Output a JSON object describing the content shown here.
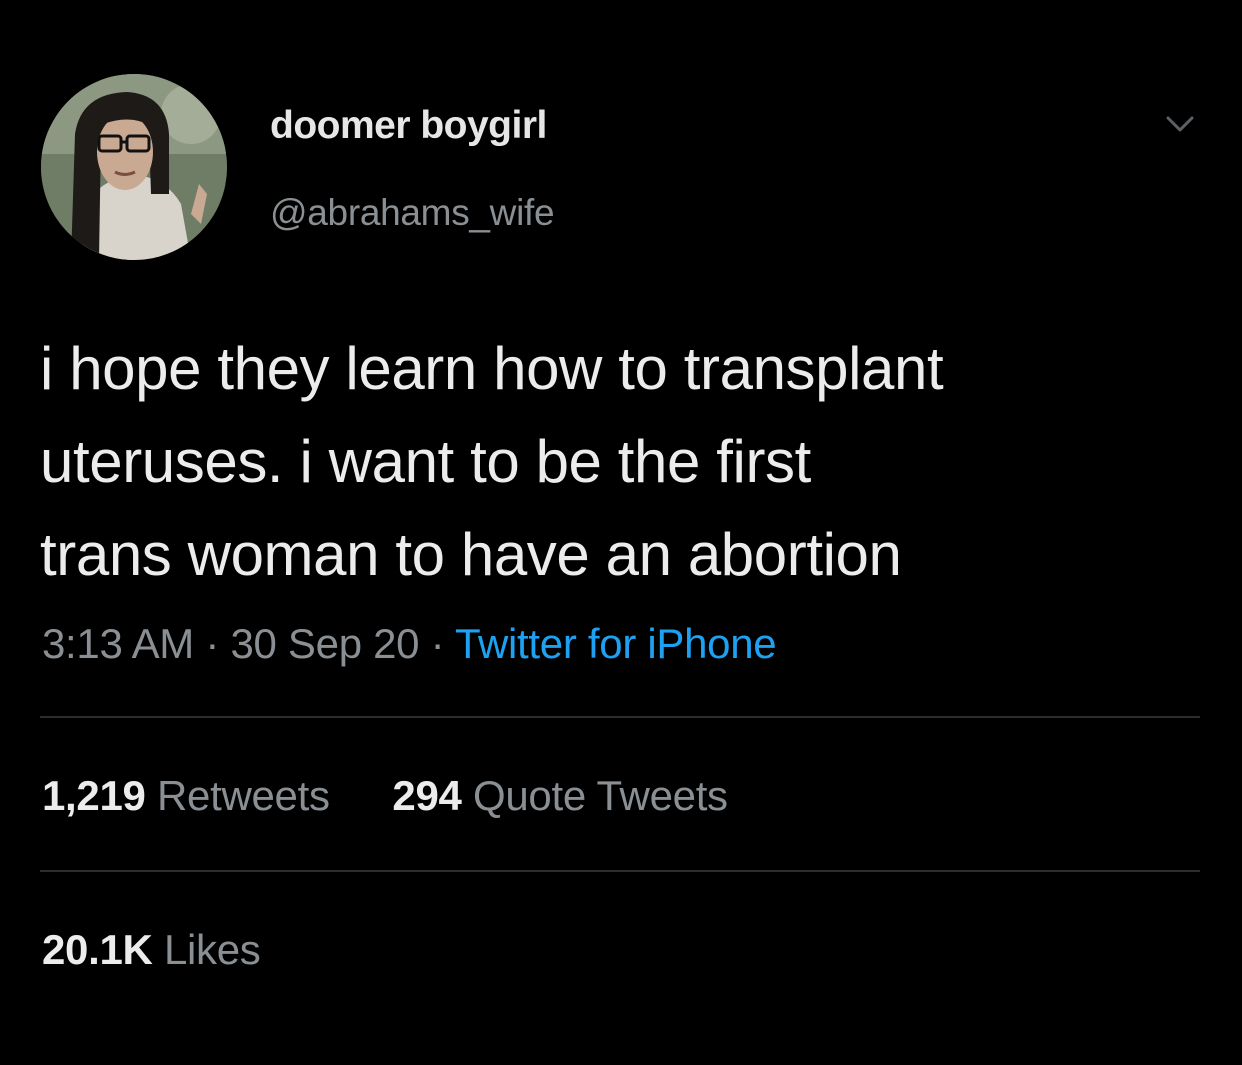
{
  "user": {
    "display_name": "doomer boygirl",
    "handle": "@abrahams_wife",
    "avatar_icon": "profile-photo"
  },
  "tweet": {
    "lines": [
      "i hope they learn how to transplant",
      "uteruses. i want to be the first",
      "trans woman to have an abortion"
    ],
    "time": "3:13 AM",
    "separator": "·",
    "date": "30 Sep 20",
    "source": "Twitter for iPhone"
  },
  "stats": {
    "retweets_count": "1,219",
    "retweets_label": "Retweets",
    "quotes_count": "294",
    "quotes_label": "Quote Tweets",
    "likes_count": "20.1K",
    "likes_label": "Likes"
  },
  "colors": {
    "background": "#000000",
    "text": "#ececec",
    "secondary": "#8a8f94",
    "link": "#1da1f2",
    "divider": "#2a2d30"
  },
  "icons": {
    "menu": "chevron-down-icon"
  }
}
